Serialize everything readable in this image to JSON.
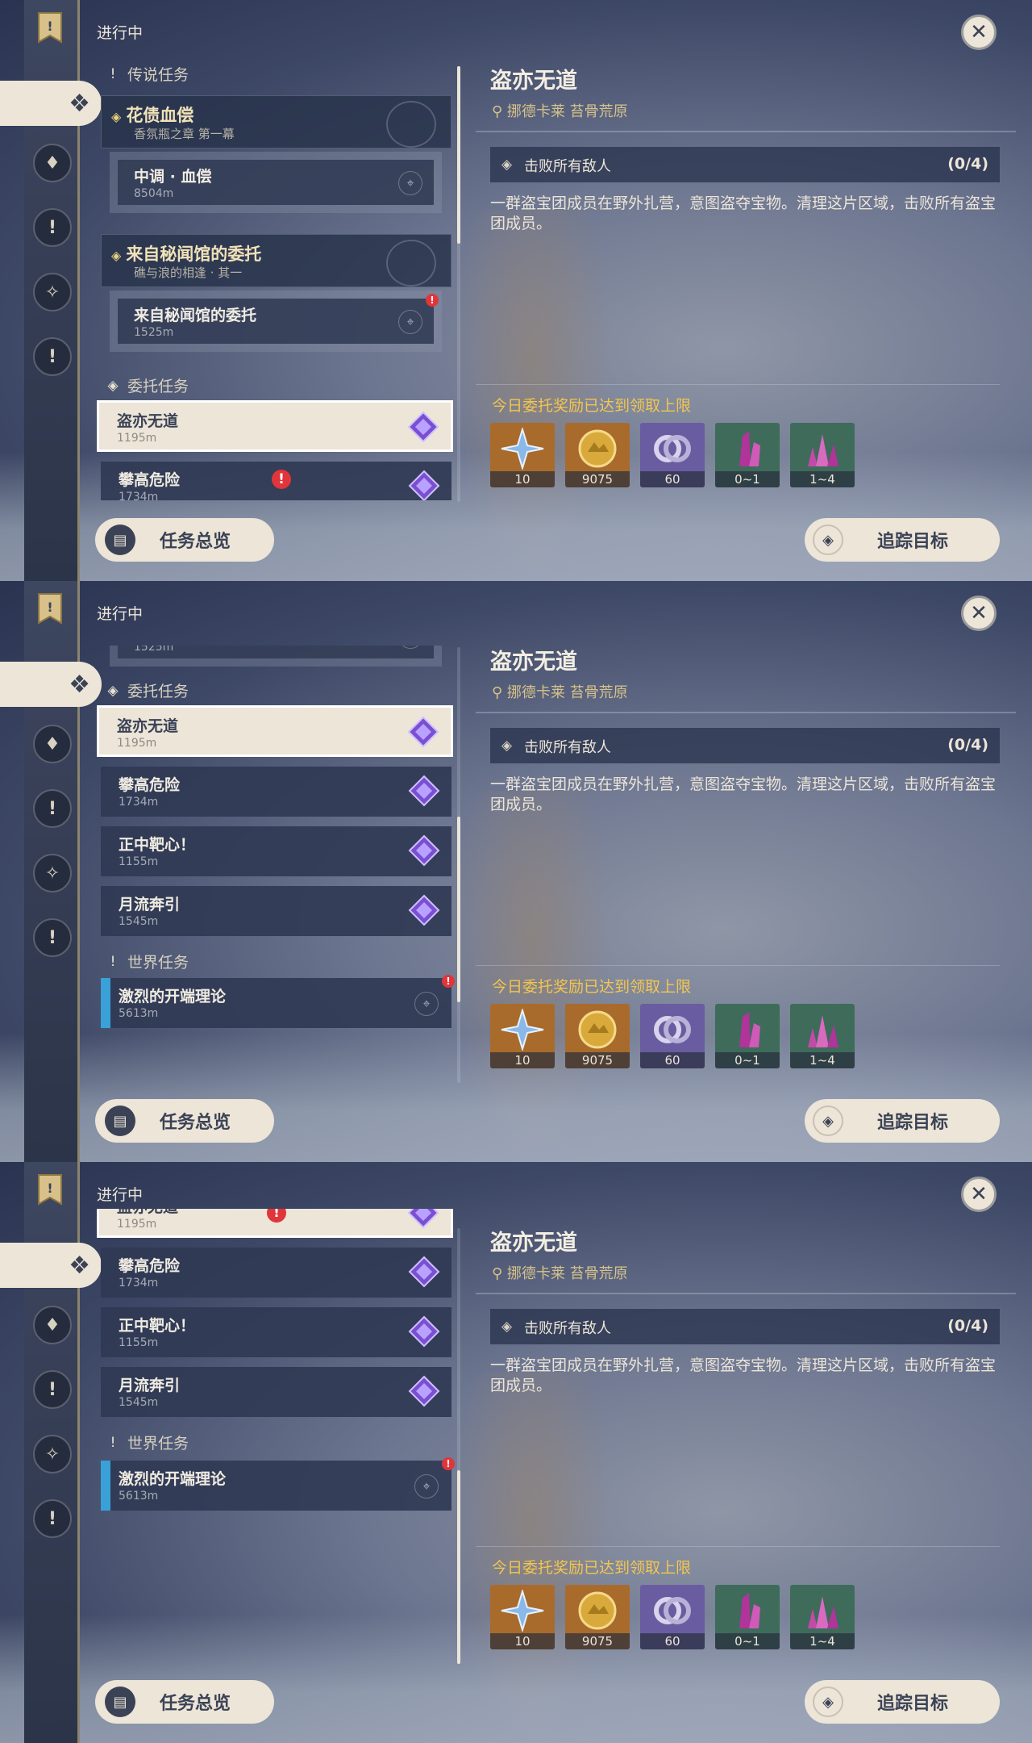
{
  "colors": {
    "accent_cream": "#ece5d8",
    "gold_text": "#f3c64e",
    "alert_red": "#e0353a",
    "panel_navy": "#30394f"
  },
  "status_label": "进行中",
  "sections": {
    "legend": "传说任务",
    "commission": "委托任务",
    "world": "世界任务"
  },
  "legend_quests": [
    {
      "title": "花债血偿",
      "subtitle": "香氛瓶之章 第一幕",
      "sub_name": "中调 · 血偿",
      "sub_dist": "8504m"
    },
    {
      "title": "来自秘闻馆的委托",
      "subtitle": "礁与浪的相逢 · 其一",
      "sub_name": "来自秘闻馆的委托",
      "sub_dist": "1525m"
    }
  ],
  "commissions": [
    {
      "name": "盗亦无道",
      "dist": "1195m"
    },
    {
      "name": "攀高危险",
      "dist": "1734m"
    },
    {
      "name": "正中靶心！",
      "dist": "1155m"
    },
    {
      "name": "月流奔引",
      "dist": "1545m"
    }
  ],
  "world_quests": [
    {
      "name": "激烈的开端理论",
      "dist": "5613m"
    }
  ],
  "detail": {
    "title": "盗亦无道",
    "location": "挪德卡莱 苔骨荒原",
    "objective": "击败所有敌人",
    "progress": "(0/4)",
    "description": "一群盗宝团成员在野外扎营，意图盗夺宝物。清理这片区域，击败所有盗宝团成员。",
    "reward_note": "今日委托奖励已达到领取上限",
    "rewards": [
      {
        "icon": "adventure-exp-icon",
        "qty": "10",
        "bg": "#a86b2c"
      },
      {
        "icon": "mora-icon",
        "qty": "9075",
        "bg": "#a86b2c"
      },
      {
        "icon": "companionship-exp-icon",
        "qty": "60",
        "bg": "#6a5ca0"
      },
      {
        "icon": "crystal-ore-icon",
        "qty": "0~1",
        "bg": "#3f6b5b"
      },
      {
        "icon": "crystal-cluster-icon",
        "qty": "1~4",
        "bg": "#3f6b5b"
      }
    ]
  },
  "buttons": {
    "overview": "任务总览",
    "track": "追踪目标"
  },
  "icons": {
    "close": "close-icon",
    "sidebar": [
      "bookmark-flag-icon",
      "commission-icon",
      "legend-quest-icon",
      "world-quest-icon",
      "event-quest-icon",
      "exclamation-icon"
    ]
  }
}
